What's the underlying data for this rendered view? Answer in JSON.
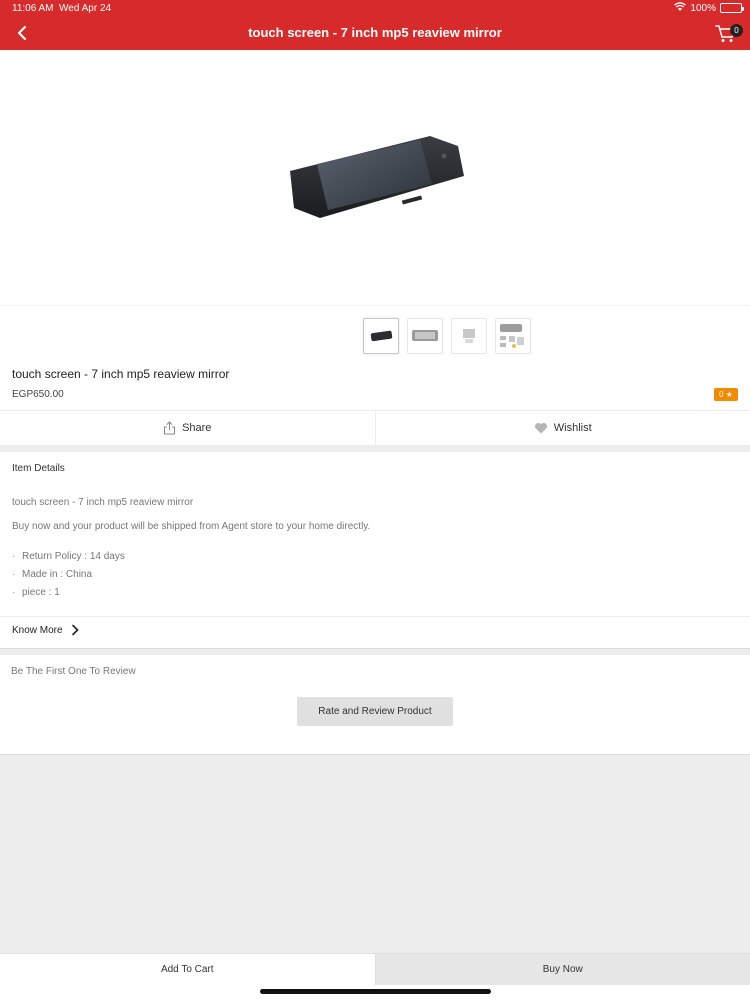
{
  "status_bar": {
    "time": "11:06 AM",
    "date": "Wed Apr 24",
    "battery_percent": "100%"
  },
  "nav": {
    "title": "touch screen - 7 inch mp5 reaview mirror",
    "cart_count": "0"
  },
  "product": {
    "title": "touch screen - 7 inch mp5 reaview mirror",
    "price": "EGP650.00",
    "rating": "0 ★"
  },
  "actions": {
    "share_label": "Share",
    "wishlist_label": "Wishlist"
  },
  "details": {
    "heading": "Item Details",
    "subtitle": "touch screen - 7 inch mp5 reaview mirror",
    "description": "Buy now and your product will be shipped from Agent store to your home directly.",
    "attributes": [
      {
        "label": "Return Policy",
        "value": "14 days"
      },
      {
        "label": "Made in",
        "value": "China"
      },
      {
        "label": "piece",
        "value": "1"
      }
    ],
    "know_more": "Know More"
  },
  "review": {
    "prompt": "Be The First One To Review",
    "button": "Rate and Review Product"
  },
  "bottom": {
    "add_to_cart": "Add To Cart",
    "buy_now": "Buy Now"
  },
  "colors": {
    "brand": "#d72a2a",
    "rating_badge": "#f28a00"
  }
}
